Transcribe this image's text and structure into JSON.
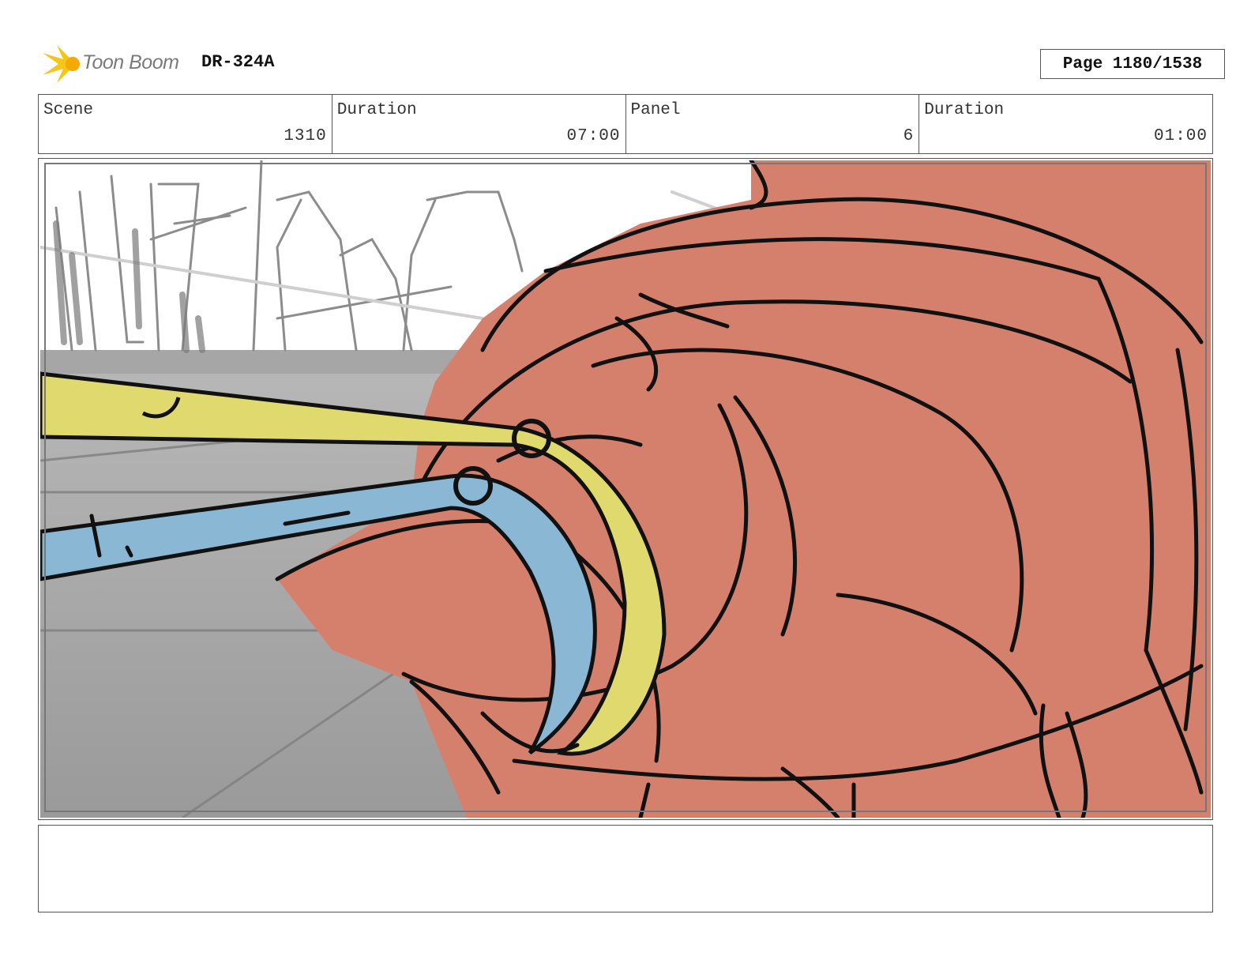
{
  "header": {
    "logo_text": "Toon Boom",
    "doc_id": "DR-324A",
    "page": "Page 1180/1538"
  },
  "info": {
    "scene_label": "Scene",
    "scene_value": "1310",
    "scene_duration_label": "Duration",
    "scene_duration_value": "07:00",
    "panel_label": "Panel",
    "panel_value": "6",
    "panel_duration_label": "Duration",
    "panel_duration_value": "01:00"
  },
  "colors": {
    "creature": "#d4806d",
    "yellow_tool": "#e0da6e",
    "blue_tool": "#8ab8d4",
    "logo_accent": "#f5c518"
  },
  "notes": ""
}
